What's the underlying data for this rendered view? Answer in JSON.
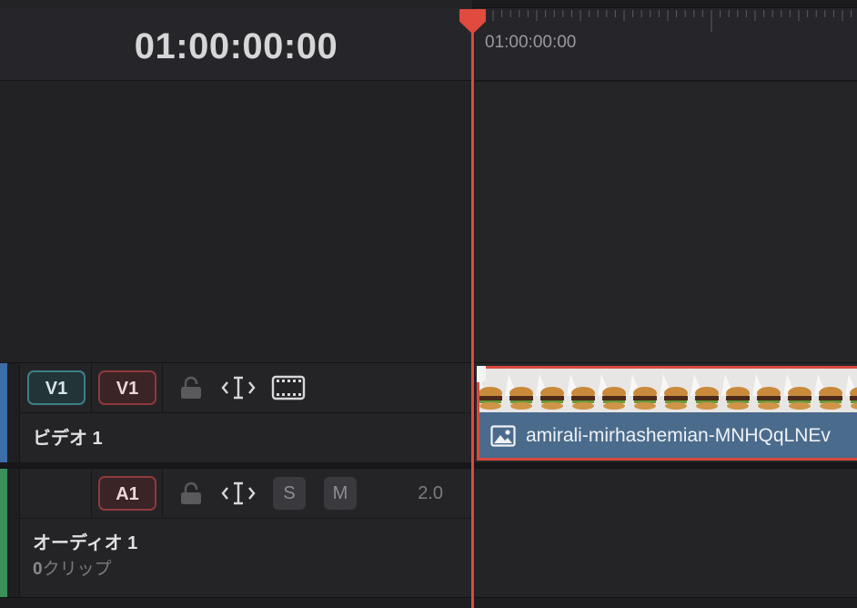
{
  "timecode": "01:00:00:00",
  "ruler": {
    "label": "01:00:00:00"
  },
  "video_track": {
    "source_label": "V1",
    "dest_label": "V1",
    "name": "ビデオ 1",
    "color": "#3d6ea8"
  },
  "audio_track": {
    "dest_label": "A1",
    "solo_label": "S",
    "mute_label": "M",
    "channels": "2.0",
    "name": "オーディオ 1",
    "clip_count": "0",
    "clip_suffix": "クリップ",
    "color": "#3b8f5a"
  },
  "clip": {
    "name": "amirali-mirhashemian-MNHQqLNEv",
    "icon": "image-icon",
    "color": "#4b6b8c"
  },
  "playhead_color": "#e04a3f"
}
